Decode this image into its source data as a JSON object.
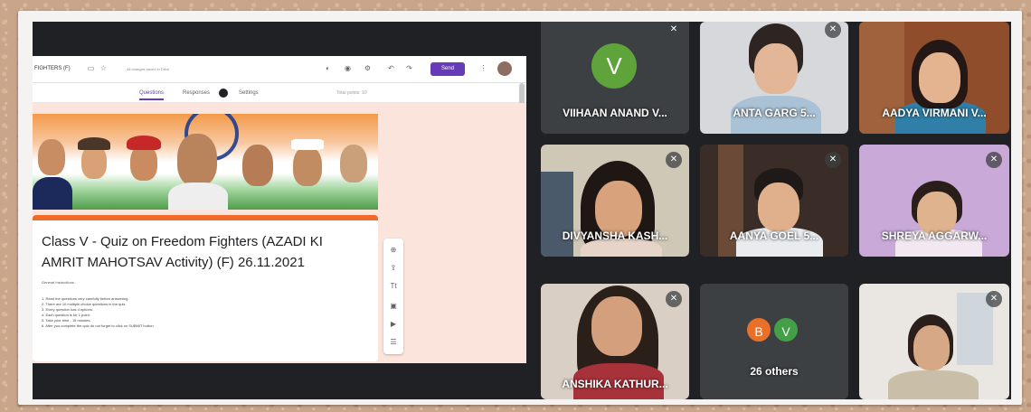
{
  "form": {
    "doc_name": "FIGHTERS (F)",
    "saved_text": "All changes saved in Drive",
    "send_label": "Send",
    "tabs": [
      "Questions",
      "Responses",
      "Settings"
    ],
    "responses_count": "26",
    "total_points": "Total points: 10",
    "title": "Class V - Quiz on Freedom Fighters (AZADI KI AMRIT MAHOTSAV Activity) (F) 26.11.2021",
    "general_instructions": "General Instructions :",
    "instructions": [
      "1. Read the questions very carefully before answering.",
      "2. There are 10 multiple choice questions in the quiz.",
      "3. Every question has 4 options.",
      "4. Each question is for 1 point.",
      "5. Take your time - 15 minutes.",
      "6. After you complete the quiz do not forget to click on SUBMIT button."
    ]
  },
  "participants": {
    "viihaan": {
      "name": "VIIHAAN ANAND V...",
      "initial": "V"
    },
    "anta": {
      "name": "ANTA GARG 5..."
    },
    "aadya": {
      "name": "AADYA VIRMANI V..."
    },
    "divyansha": {
      "name": "DIVYANSHA KASH..."
    },
    "aanya": {
      "name": "AANYA GOEL 5..."
    },
    "shreya": {
      "name": "SHREYA AGGARW..."
    },
    "anshika": {
      "name": "ANSHIKA KATHUR..."
    },
    "others": {
      "label": "26 others",
      "initials": [
        "B",
        "V"
      ]
    }
  },
  "colors": {
    "screen_bg": "#202124",
    "tile_bg": "#3c4043",
    "avatar_v": "#5fa33b",
    "avatar_b": "#e8702a",
    "avatar_v2": "#43a047",
    "forms_purple": "#673ab7"
  }
}
